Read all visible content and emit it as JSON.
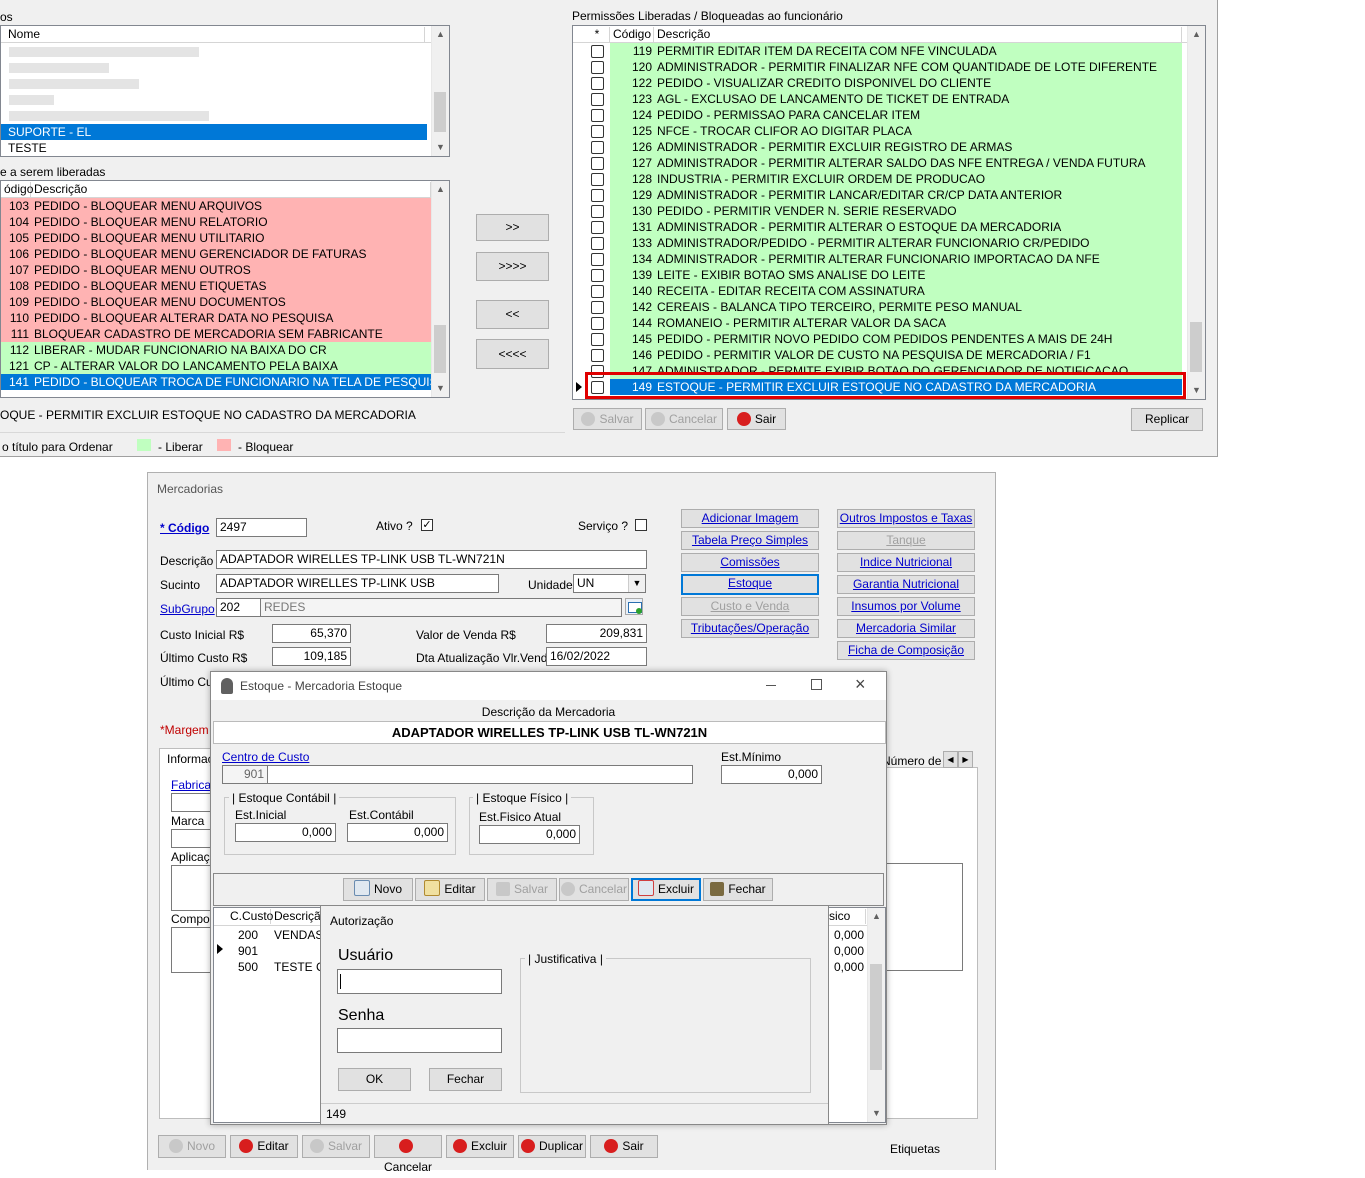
{
  "top_left": {
    "section_label": "os",
    "users_header": "Nome",
    "users": [
      "",
      "",
      "",
      "",
      "",
      "SUPORTE - EL",
      "TESTE"
    ],
    "blocked_label": "e a serem liberadas",
    "blocked_headers": [
      "ódigo",
      "Descrição"
    ],
    "blocked_rows": [
      {
        "code": "103",
        "desc": "PEDIDO - BLOQUEAR MENU ARQUIVOS",
        "state": "red"
      },
      {
        "code": "104",
        "desc": "PEDIDO - BLOQUEAR MENU RELATORIO",
        "state": "red"
      },
      {
        "code": "105",
        "desc": "PEDIDO - BLOQUEAR MENU UTILITARIO",
        "state": "red"
      },
      {
        "code": "106",
        "desc": "PEDIDO - BLOQUEAR MENU GERENCIADOR DE FATURAS",
        "state": "red"
      },
      {
        "code": "107",
        "desc": "PEDIDO - BLOQUEAR MENU OUTROS",
        "state": "red"
      },
      {
        "code": "108",
        "desc": "PEDIDO - BLOQUEAR MENU ETIQUETAS",
        "state": "red"
      },
      {
        "code": "109",
        "desc": "PEDIDO - BLOQUEAR MENU DOCUMENTOS",
        "state": "red"
      },
      {
        "code": "110",
        "desc": "PEDIDO - BLOQUEAR ALTERAR DATA NO PESQUISA",
        "state": "red"
      },
      {
        "code": "111",
        "desc": "BLOQUEAR CADASTRO DE MERCADORIA SEM FABRICANTE",
        "state": "red"
      },
      {
        "code": "112",
        "desc": "LIBERAR - MUDAR FUNCIONARIO NA BAIXA DO CR",
        "state": "grn"
      },
      {
        "code": "121",
        "desc": "CP - ALTERAR VALOR DO LANCAMENTO PELA BAIXA",
        "state": "grn"
      },
      {
        "code": "141",
        "desc": "PEDIDO - BLOQUEAR TROCA DE FUNCIONARIO NA TELA DE PESQUISA DO P",
        "state": "sel"
      }
    ],
    "selected_desc": "OQUE - PERMITIR EXCLUIR ESTOQUE NO CADASTRO DA MERCADORIA",
    "legend_hint": "o título para Ordenar",
    "legend_liberar": "- Liberar",
    "legend_bloquear": "- Bloquear",
    "colors": {
      "liberar": "#c0ffc0",
      "bloquear": "#ffb3b3",
      "selected": "#0078d7",
      "highlight_box": "#e00000"
    }
  },
  "transfer_buttons": [
    ">>",
    ">>>>",
    "<<",
    "<<<<"
  ],
  "top_right": {
    "label": "Permissões Liberadas / Bloqueadas ao funcionário",
    "headers": [
      "*",
      "Código",
      "Descrição"
    ],
    "rows": [
      {
        "code": "119",
        "desc": "PERMITIR EDITAR ITEM DA RECEITA COM NFE VINCULADA"
      },
      {
        "code": "120",
        "desc": "ADMINISTRADOR - PERMITIR FINALIZAR NFE COM QUANTIDADE DE LOTE DIFERENTE"
      },
      {
        "code": "122",
        "desc": "PEDIDO - VISUALIZAR CREDITO DISPONIVEL DO CLIENTE"
      },
      {
        "code": "123",
        "desc": "AGL - EXCLUSAO DE LANCAMENTO DE TICKET DE ENTRADA"
      },
      {
        "code": "124",
        "desc": "PEDIDO - PERMISSAO PARA CANCELAR ITEM"
      },
      {
        "code": "125",
        "desc": "NFCE - TROCAR CLIFOR AO DIGITAR PLACA"
      },
      {
        "code": "126",
        "desc": "ADMINISTRADOR - PERMITIR EXCLUIR REGISTRO DE ARMAS"
      },
      {
        "code": "127",
        "desc": "ADMINISTRADOR - PERMITIR ALTERAR SALDO DAS NFE ENTREGA / VENDA FUTURA"
      },
      {
        "code": "128",
        "desc": "INDUSTRIA - PERMITIR EXCLUIR ORDEM DE PRODUCAO"
      },
      {
        "code": "129",
        "desc": "ADMINISTRADOR - PERMITIR LANCAR/EDITAR CR/CP DATA ANTERIOR"
      },
      {
        "code": "130",
        "desc": "PEDIDO - PERMITIR VENDER N. SERIE RESERVADO"
      },
      {
        "code": "131",
        "desc": "ADMINISTRADOR - PERMITIR ALTERAR O ESTOQUE DA MERCADORIA"
      },
      {
        "code": "133",
        "desc": "ADMINISTRADOR/PEDIDO - PERMITIR ALTERAR FUNCIONARIO CR/PEDIDO"
      },
      {
        "code": "134",
        "desc": "ADMINISTRADOR - PERMITIR ALTERAR FUNCIONARIO IMPORTACAO DA NFE"
      },
      {
        "code": "139",
        "desc": "LEITE - EXIBIR BOTAO SMS ANALISE DO LEITE"
      },
      {
        "code": "140",
        "desc": "RECEITA - EDITAR RECEITA COM ASSINATURA"
      },
      {
        "code": "142",
        "desc": "CEREAIS - BALANCA TIPO TERCEIRO, PERMITE PESO MANUAL"
      },
      {
        "code": "144",
        "desc": "ROMANEIO - PERMITIR ALTERAR VALOR DA SACA"
      },
      {
        "code": "145",
        "desc": "PEDIDO - PERMITIR NOVO PEDIDO COM PEDIDOS PENDENTES A MAIS DE 24H"
      },
      {
        "code": "146",
        "desc": "PEDIDO - PERMITIR VALOR DE CUSTO NA PESQUISA DE MERCADORIA / F1"
      },
      {
        "code": "147",
        "desc": "ADMINISTRADOR - PERMITE EXIBIR BOTAO DO GERENCIADOR DE NOTIFICACAO"
      },
      {
        "code": "149",
        "desc": "ESTOQUE - PERMITIR EXCLUIR ESTOQUE NO CADASTRO DA MERCADORIA"
      }
    ],
    "btn_salvar": "Salvar",
    "btn_cancelar": "Cancelar",
    "btn_sair": "Sair",
    "btn_replicar": "Replicar"
  },
  "merc": {
    "title": "Mercadorias",
    "codigo_label": "* Código",
    "codigo": "2497",
    "ativo_label": "Ativo ?",
    "ativo_mark": "✓",
    "servico_label": "Serviço ?",
    "descricao_label": "Descrição",
    "descricao": "ADAPTADOR WIRELLES TP-LINK USB TL-WN721N",
    "sucinto_label": "Sucinto",
    "sucinto": "ADAPTADOR WIRELLES TP-LINK USB",
    "unidade_label": "Unidade",
    "unidade": "UN",
    "subgrupo_label": "SubGrupo",
    "subgrupo_code": "202",
    "subgrupo_name": "REDES",
    "custo_inicial_label": "Custo Inicial R$",
    "custo_inicial": "65,370",
    "ultimo_custo_label": "Último Custo R$",
    "ultimo_custo": "109,185",
    "valor_venda_label": "Valor de Venda R$",
    "valor_venda": "209,831",
    "dta_label": "Dta Atualização Vlr.Venda",
    "dta": "16/02/2022",
    "ultimo_cus_label": "Último Cus",
    "margem_label": "*Margem d",
    "tab_info": "Informaçõ",
    "tab_numero": "Número de S",
    "fabricante_label": "Fabrican",
    "marca_label": "Marca",
    "aplicacao_label": "Aplicaçã",
    "composicao_label": "Composi",
    "etiquetas": "Etiquetas",
    "links_left": [
      "Adicionar Imagem",
      "Tabela Preço Simples",
      "Comissões",
      "Estoque",
      "Custo e Venda",
      "Tributações/Operação"
    ],
    "links_right": [
      "Outros Impostos e Taxas",
      "Tanque",
      "Indice Nutricional",
      "Garantia Nutricional",
      "Insumos por Volume",
      "Mercadoria Similar",
      "Ficha de Composição"
    ],
    "bottom_buttons": [
      "Novo",
      "Editar",
      "Salvar",
      "Cancelar",
      "Excluir",
      "Duplicar",
      "Sair"
    ]
  },
  "estoque": {
    "title": "Estoque - Mercadoria Estoque",
    "desc_header": "Descrição da Mercadoria",
    "desc": "ADAPTADOR WIRELLES TP-LINK USB TL-WN721N",
    "centro_label": "Centro de Custo",
    "centro_code": "901",
    "est_min_label": "Est.Mínimo",
    "est_min": "0,000",
    "contabil_group": "Estoque Contábil",
    "est_inicial_label": "Est.Inicial",
    "est_inicial": "0,000",
    "est_contabil_label": "Est.Contábil",
    "est_contabil": "0,000",
    "fisico_group": "Estoque Físico",
    "fisico_atual_label": "Est.Fisico Atual",
    "fisico_atual": "0,000",
    "toolbar": [
      "Novo",
      "Editar",
      "Salvar",
      "Cancelar",
      "Excluir",
      "Fechar"
    ],
    "grid_headers": [
      "C.Custo",
      "Descrição",
      "sico"
    ],
    "grid_rows": [
      {
        "code": "200",
        "desc": "VENDAS",
        "val": "0,000"
      },
      {
        "code": "901",
        "desc": "",
        "val": "0,000"
      },
      {
        "code": "500",
        "desc": "TESTE CC",
        "val": "0,000"
      }
    ]
  },
  "auth": {
    "title": "Autorização",
    "usuario_label": "Usuário",
    "senha_label": "Senha",
    "justificativa_label": "Justificativa",
    "ok": "OK",
    "fechar": "Fechar",
    "status": "149"
  }
}
